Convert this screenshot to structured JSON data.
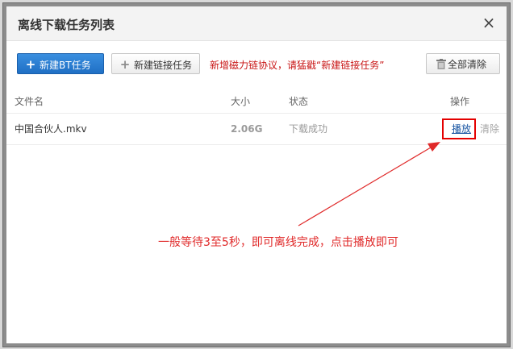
{
  "dialog": {
    "title": "离线下载任务列表",
    "close_glyph": "×"
  },
  "toolbar": {
    "new_bt_label": "新建BT任务",
    "new_link_label": "新建链接任务",
    "notice": "新增磁力链协议，请猛戳“新建链接任务”",
    "clear_all_label": "全部清除",
    "icons": {
      "new_bt": "plus-icon",
      "new_link": "plus-icon",
      "clear_all": "trash-icon"
    }
  },
  "table": {
    "headers": [
      "文件名",
      "大小",
      "状态",
      "操作"
    ],
    "rows": [
      {
        "name": "中国合伙人.mkv",
        "size": "2.06G",
        "status": "下载成功",
        "play": "播放",
        "clear": "清除"
      }
    ]
  },
  "annotation": {
    "text": "一般等待3至5秒，即可离线完成，点击播放即可",
    "color": "#e02a2a"
  },
  "colors": {
    "primary": "#1f6fc4",
    "notice": "#c81414",
    "highlight_box": "#e40000",
    "link": "#1a56a3"
  }
}
